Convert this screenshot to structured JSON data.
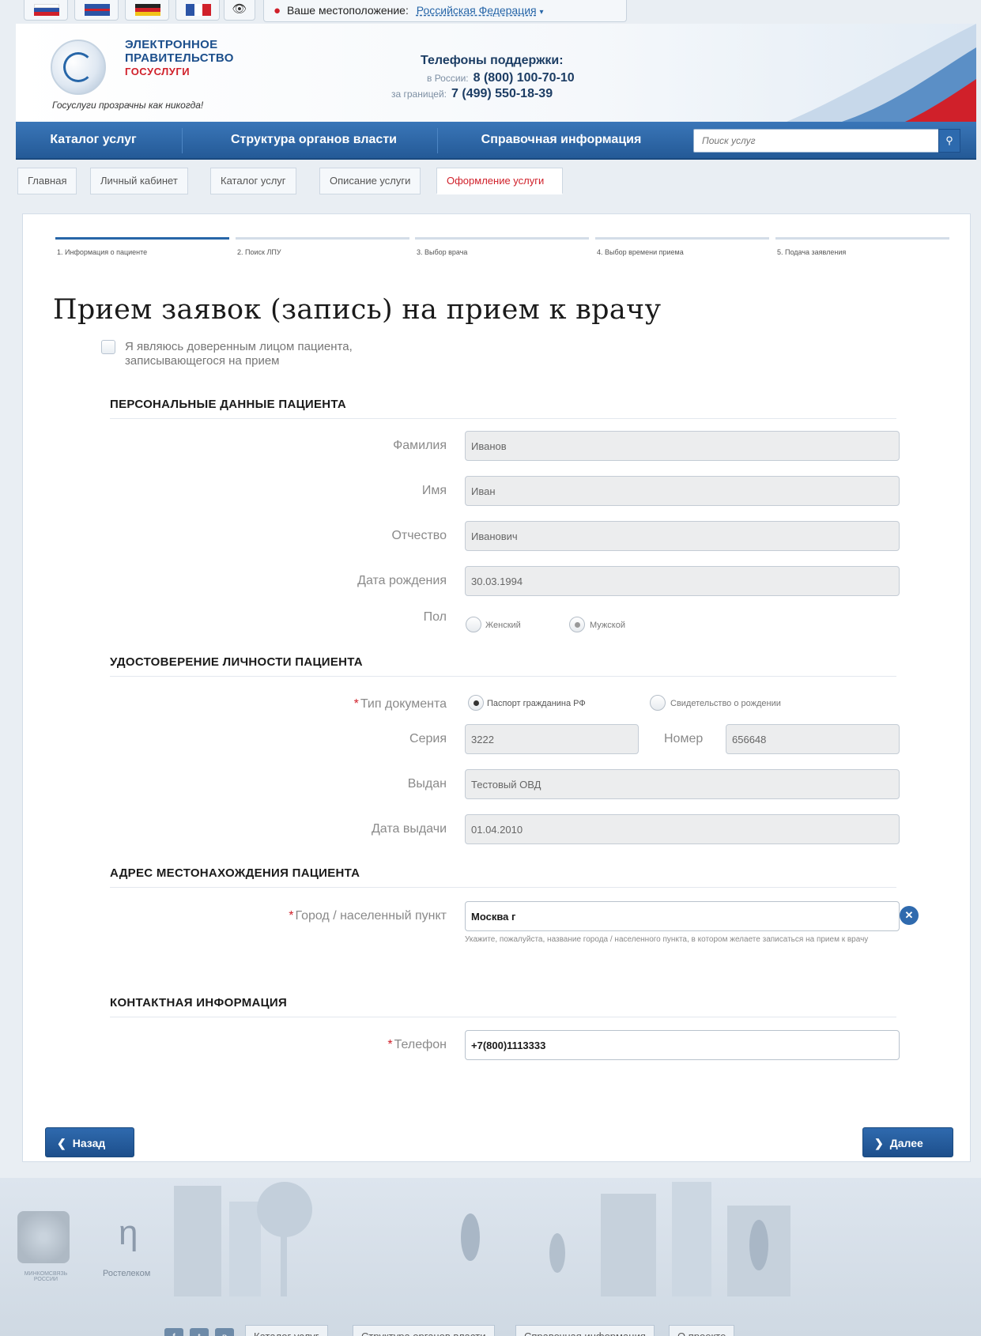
{
  "language_flags": [
    {
      "name": "russian-flag",
      "colors": [
        "#ffffff",
        "#2b54a6",
        "#d0202a"
      ]
    },
    {
      "name": "english-flag",
      "colors": [
        "#ffffff",
        "#2b54a6",
        "#d0202a"
      ]
    },
    {
      "name": "german-flag",
      "colors": [
        "#222222",
        "#d0202a",
        "#f2c318"
      ]
    },
    {
      "name": "french-flag",
      "colors": [
        "#2b54a6",
        "#ffffff",
        "#d0202a"
      ]
    }
  ],
  "accessibility_icon": "eye-icon",
  "location": {
    "label": "Ваше местоположение:",
    "value": "Российская Федерация"
  },
  "header": {
    "logo_line1": "ЭЛЕКТРОННОЕ",
    "logo_line2": "ПРАВИТЕЛЬСТВО",
    "logo_line3": "ГОСУСЛУГИ",
    "slogan": "Госуслуги прозрачны как никогда!",
    "support_title": "Телефоны поддержки:",
    "support_russia_label": "в России:",
    "support_russia_phone": "8 (800) 100-70-10",
    "support_abroad_label": "за границей:",
    "support_abroad_phone": "7 (499) 550-18-39"
  },
  "nav": {
    "items": [
      "Каталог услуг",
      "Структура органов власти",
      "Справочная информация"
    ],
    "search_placeholder": "Поиск услуг"
  },
  "breadcrumb": [
    "Главная",
    "Личный кабинет",
    "Каталог услуг",
    "Описание услуги",
    "Оформление услуги"
  ],
  "steps": [
    "1. Информация о пациенте",
    "2. Поиск ЛПУ",
    "3. Выбор врача",
    "4. Выбор времени приема",
    "5. Подача заявления"
  ],
  "current_step": 1,
  "page_title": "Прием заявок (запись) на прием к врачу",
  "proxy_checkbox": {
    "line1": "Я являюсь доверенным лицом пациента,",
    "line2": "записывающегося на прием",
    "checked": false
  },
  "personal": {
    "title": "ПЕРСОНАЛЬНЫЕ ДАННЫЕ ПАЦИЕНТА",
    "surname_label": "Фамилия",
    "surname": "Иванов",
    "name_label": "Имя",
    "name": "Иван",
    "patronymic_label": "Отчество",
    "patronymic": "Иванович",
    "birthdate_label": "Дата рождения",
    "birthdate": "30.03.1994",
    "sex_label": "Пол",
    "sex_female": "Женский",
    "sex_male": "Мужской",
    "sex_selected": "Мужской"
  },
  "identity": {
    "title": "УДОСТОВЕРЕНИЕ ЛИЧНОСТИ ПАЦИЕНТА",
    "doc_type_label": "Тип документа",
    "doc_passport": "Паспорт гражданина РФ",
    "doc_birth_cert": "Свидетельство о рождении",
    "doc_selected": "Паспорт гражданина РФ",
    "series_label": "Серия",
    "series": "3222",
    "number_label": "Номер",
    "number": "656648",
    "issued_by_label": "Выдан",
    "issued_by": "Тестовый ОВД",
    "issue_date_label": "Дата выдачи",
    "issue_date": "01.04.2010"
  },
  "address": {
    "title": "АДРЕС МЕСТОНАХОЖДЕНИЯ ПАЦИЕНТА",
    "city_label": "Город / населенный пункт",
    "city": "Москва г",
    "hint": "Укажите, пожалуйста, название города / населенного пункта, в котором желаете записаться на прием к врачу"
  },
  "contact": {
    "title": "КОНТАКТНАЯ ИНФОРМАЦИЯ",
    "phone_label": "Телефон",
    "phone": "+7(800)1113333"
  },
  "buttons": {
    "back": "Назад",
    "next": "Далее"
  },
  "footer": {
    "emblem_caption": "МИНКОМСВЯЗЬ РОССИИ",
    "partner": "Ростелеком",
    "social_icons": [
      "facebook-icon",
      "twitter-icon",
      "vk-icon"
    ],
    "links": [
      "Каталог услуг",
      "Структура органов власти",
      "Справочная информация",
      "О проекте"
    ]
  },
  "colors": {
    "nav_blue": "#2d6aae",
    "active_red": "#d0202a",
    "title_blue": "#1c4f8c"
  }
}
